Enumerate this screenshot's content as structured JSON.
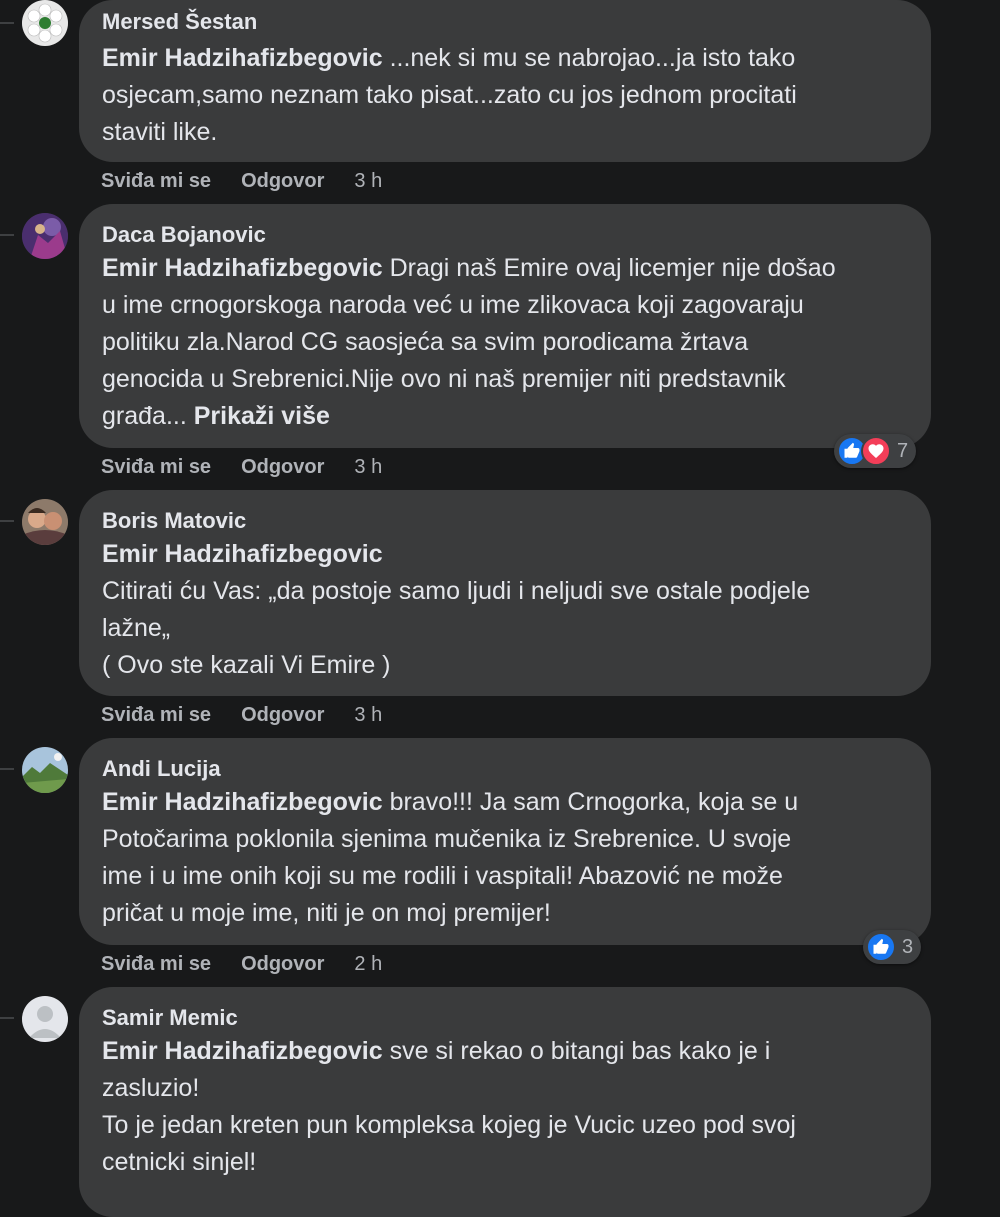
{
  "actions": {
    "like_label": "Sviđa mi se",
    "reply_label": "Odgovor"
  },
  "comments": [
    {
      "author": "Mersed Šestan",
      "mention": "Emir Hadzihafizbegovic",
      "lines": [
        " ...nek si mu se nabrojao...ja isto tako",
        "osjecam,samo neznam tako pisat...zato cu jos jednom procitati",
        "staviti like."
      ],
      "time": "3 h",
      "avatar_icon": "flower-avatar-icon"
    },
    {
      "author": "Daca Bojanovic",
      "mention": "Emir Hadzihafizbegovic",
      "lines": [
        " Dragi naš Emire ovaj licemjer nije došao",
        "u ime crnogorskoga naroda već u ime zlikovaca koji zagovaraju",
        "politiku zla.Narod CG saosjeća sa svim porodicama žrtava",
        "genocida u Srebrenici.Nije ovo ni naš premijer niti predstavnik",
        "građa... "
      ],
      "see_more": "Prikaži više",
      "time": "3 h",
      "reaction_count": "7",
      "reaction_icons": [
        "like-icon",
        "love-icon"
      ],
      "avatar_icon": "photo-avatar-icon"
    },
    {
      "author": "Boris Matovic",
      "mention": "Emir Hadzihafizbegovic",
      "lines": [
        "Citirati ću Vas: „da postoje samo ljudi i neljudi sve ostale podjele",
        "lažne„",
        "( Ovo ste kazali Vi Emire )"
      ],
      "time": "3 h",
      "avatar_icon": "photo-avatar-icon"
    },
    {
      "author": "Andi Lucija",
      "mention": "Emir Hadzihafizbegovic",
      "lines": [
        " bravo!!! Ja sam Crnogorka, koja se u",
        "Potočarima poklonila sjenima mučenika iz Srebrenice. U svoje",
        "ime i u ime onih koji su me rodili i vaspitali! Abazović ne može",
        "pričat u moje ime, niti je on moj premijer!"
      ],
      "time": "2 h",
      "reaction_count": "3",
      "reaction_icons": [
        "like-icon"
      ],
      "avatar_icon": "landscape-avatar-icon"
    },
    {
      "author": "Samir Memic",
      "mention": "Emir Hadzihafizbegovic",
      "lines": [
        " sve si rekao o bitangi bas kako je i",
        "zasluzio!",
        "To je jedan kreten pun kompleksa kojeg je Vucic uzeo pod svoj",
        "cetnicki sinjel!"
      ],
      "avatar_icon": "default-user-avatar-icon"
    }
  ],
  "colors": {
    "background": "#18191a",
    "bubble": "#3a3b3c",
    "text": "#e4e6eb",
    "muted": "#b0b3b8",
    "like_blue": "#1877f2",
    "love_red": "#f33e58"
  }
}
